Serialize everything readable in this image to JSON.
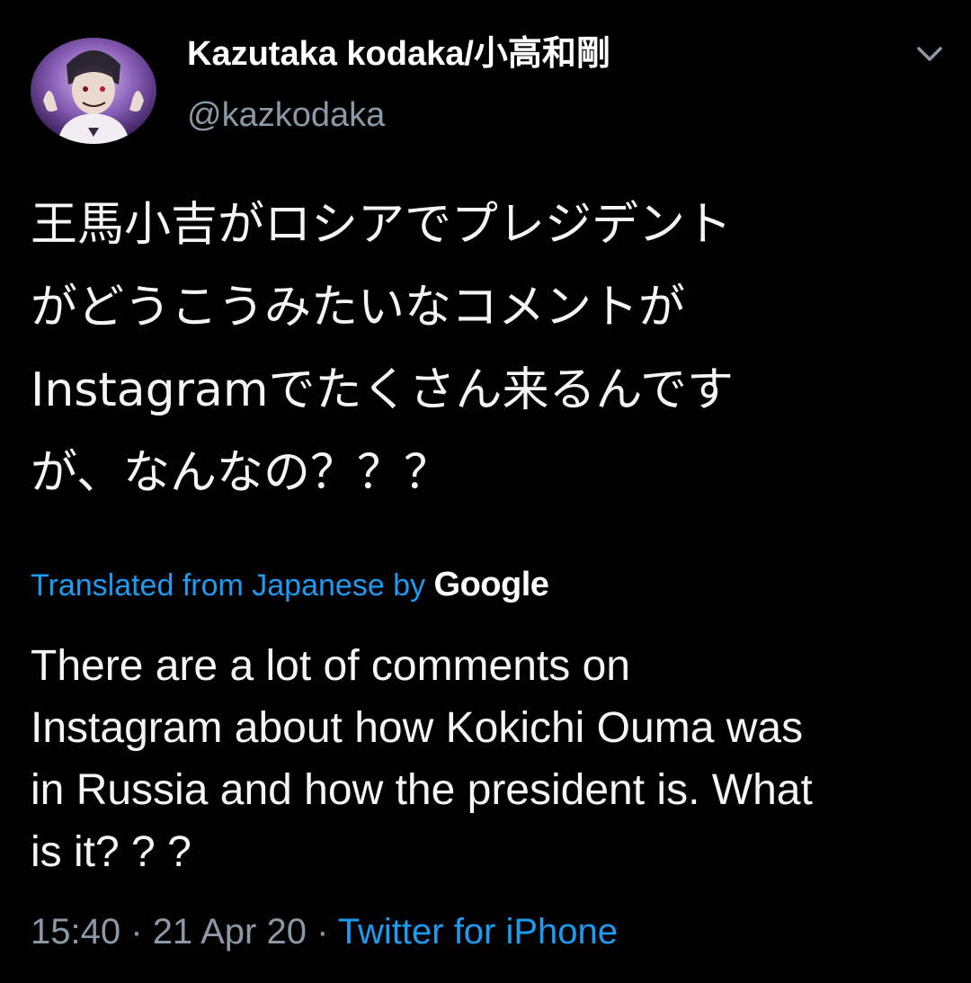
{
  "author": {
    "display_name": "Kazutaka kodaka/小高和剛",
    "handle": "@kazkodaka"
  },
  "tweet": {
    "lines": [
      "王馬小吉がロシアでプレジデント",
      "がどうこうみたいなコメントが",
      "Instagramでたくさん来るんです",
      "が、なんなの？？？"
    ]
  },
  "translation": {
    "label": "Translated from Japanese by",
    "provider": "Google",
    "lines": [
      "There are a lot of comments on",
      "Instagram about how Kokichi Ouma was",
      "in Russia and how the president is. What",
      "is it? ? ?"
    ]
  },
  "meta": {
    "time": "15:40",
    "separator": "·",
    "date": "21 Apr 20",
    "source": "Twitter for iPhone"
  },
  "colors": {
    "background": "#000000",
    "link": "#1d9bf0",
    "secondary_text": "#8b98a5",
    "primary_text": "#f5f5f5"
  },
  "icons": {
    "menu": "chevron-down-icon"
  }
}
